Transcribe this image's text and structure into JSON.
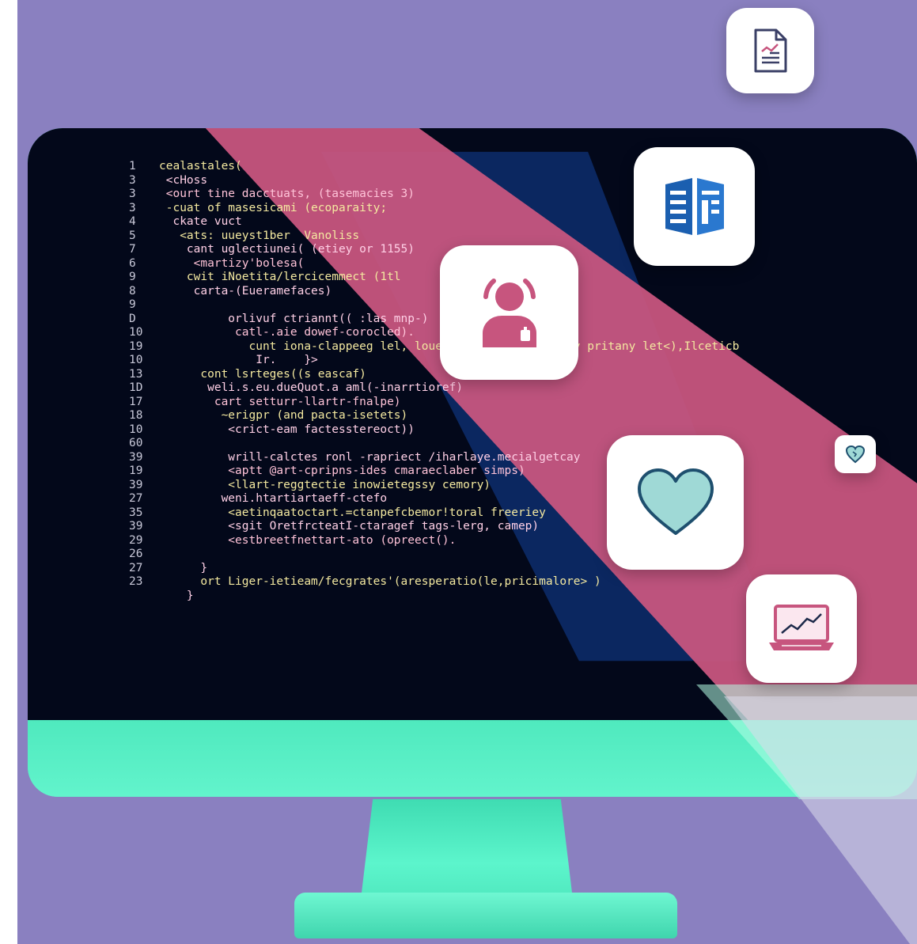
{
  "code_lines": [
    {
      "n": "1",
      "t": "cealastales("
    },
    {
      "n": "3",
      "t": " <cHoss"
    },
    {
      "n": "3",
      "t": " <ourt tine dacctuats, (tasemacies 3)"
    },
    {
      "n": "3",
      "t": " -cuat of masesicami (ecoparaity;"
    },
    {
      "n": "4",
      "t": "  ckate vuct"
    },
    {
      "n": "5",
      "t": "   <ats: uueyst1ber  Vanoliss"
    },
    {
      "n": "7",
      "t": "    cant uglectiunei( (etiey or 1155)"
    },
    {
      "n": "6",
      "t": "     <martizy'bolesa("
    },
    {
      "n": "9",
      "t": "    cwit iNoetita/lercicemmect (1tl"
    },
    {
      "n": "8",
      "t": "     carta-(Eueramefaces)"
    },
    {
      "n": "9",
      "t": ""
    },
    {
      "n": "D",
      "t": "          orlivuf ctriannt(( :las mnp-)"
    },
    {
      "n": "10",
      "t": "           catl-.aie dowef-corocled)."
    },
    {
      "n": "19",
      "t": "             cunt iona-clappeeg lel, louer               wary pritany let<),Ilceticb"
    },
    {
      "n": "10",
      "t": "              Ir.    }>"
    },
    {
      "n": "13",
      "t": "      cont lsrteges((s eascaf)"
    },
    {
      "n": "1D",
      "t": "       weli.s.eu.dueQuot.a aml(-inarrtioref)"
    },
    {
      "n": "17",
      "t": "        cart setturr-llartr-fnalpe)"
    },
    {
      "n": "18",
      "t": "         ~erigpr (and pacta-isetets)"
    },
    {
      "n": "10",
      "t": "          <crict-eam factesstereoct))"
    },
    {
      "n": "60",
      "t": ""
    },
    {
      "n": "39",
      "t": "          wrill-calctes ronl -rapriect /iharlaye.mecialgetcay"
    },
    {
      "n": "19",
      "t": "          <aptt @art-cpripns-ides cmaraeclaber simps)"
    },
    {
      "n": "39",
      "t": "          <llart-reggtectie inowietegssy cemory)"
    },
    {
      "n": "27",
      "t": "         weni.htartiartaeff-ctefo"
    },
    {
      "n": "35",
      "t": "          <aetinqaatoctart.=ctanpefcbemor!toral freeriey"
    },
    {
      "n": "39",
      "t": "          <sgit OretfrcteatI-ctaragef tags-lerg, camep)"
    },
    {
      "n": "29",
      "t": "          <estbreetfnettart-ato (opreect()."
    },
    {
      "n": "26",
      "t": ""
    },
    {
      "n": "27",
      "t": "      }"
    },
    {
      "n": "23",
      "t": "      ort Liger-ietieam/fecgrates'(aresperatio(le,pricimalore> )"
    },
    {
      "n": "",
      "t": "    }"
    }
  ],
  "icons": {
    "document": "document-chart-icon",
    "book": "blue-document-icon",
    "user": "user-profile-icon",
    "heart": "heart-icon",
    "heart_small": "heart-badge-icon",
    "laptop": "laptop-chart-icon"
  },
  "colors": {
    "background": "#8a80c0",
    "screen": "#03081a",
    "band_pink": "#c7557e",
    "band_blue": "#0c2a66",
    "monitor_body": "#5cf0c6",
    "icon_pink": "#c7557e",
    "icon_blue": "#1b5fb0",
    "heart_fill": "#9fd9d6"
  }
}
